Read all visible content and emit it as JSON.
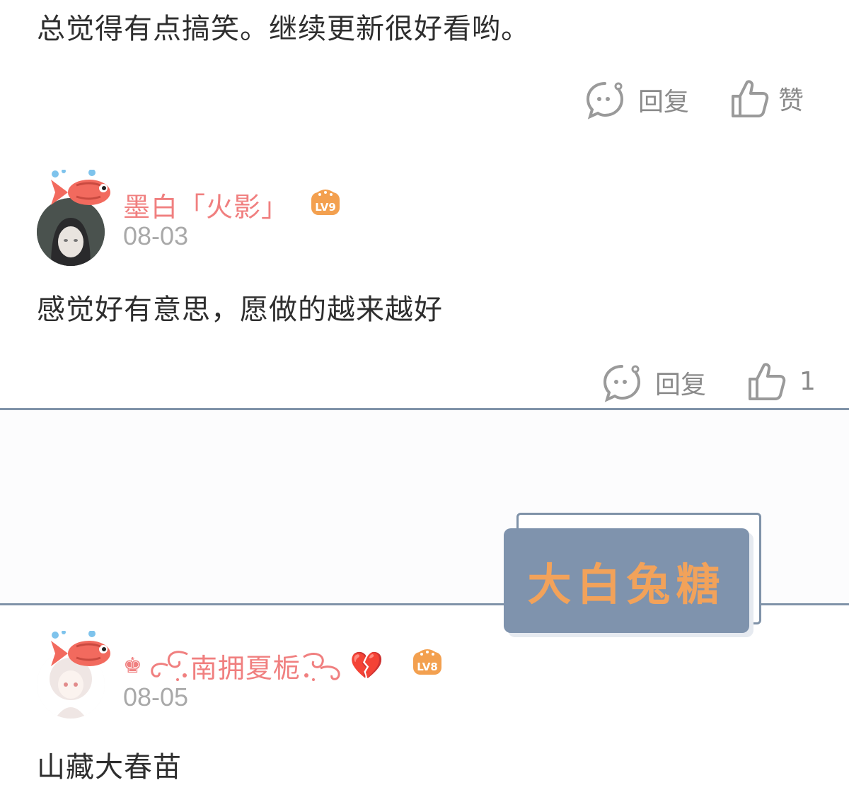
{
  "comments": [
    {
      "text": "总觉得有点搞笑。继续更新很好看哟。",
      "reply_label": "回复",
      "like_label": "赞"
    },
    {
      "username": "墨白「火影」",
      "level": "LV9",
      "date": "08-03",
      "text": "感觉好有意思，愿做的越来越好",
      "reply_label": "回复",
      "like_count": "1"
    },
    {
      "username_prefix": "♚",
      "username": "南拥夏栀",
      "username_emoji": "💔",
      "level": "LV8",
      "date": "08-05",
      "text": "山藏大春苗"
    }
  ],
  "watermark": {
    "text": "大白兔糖"
  },
  "colors": {
    "username": "#f07f7f",
    "divider": "#7f92a8",
    "action_gray": "#8a8a8a",
    "level_badge": "#f3a04f",
    "sticker_bg": "#7f93ad",
    "sticker_text": "#f2a25a"
  },
  "icons": {
    "reply": "comment-bubble-icon",
    "like": "thumbs-up-icon",
    "avatar_decoration": "koi-fish-icon"
  }
}
